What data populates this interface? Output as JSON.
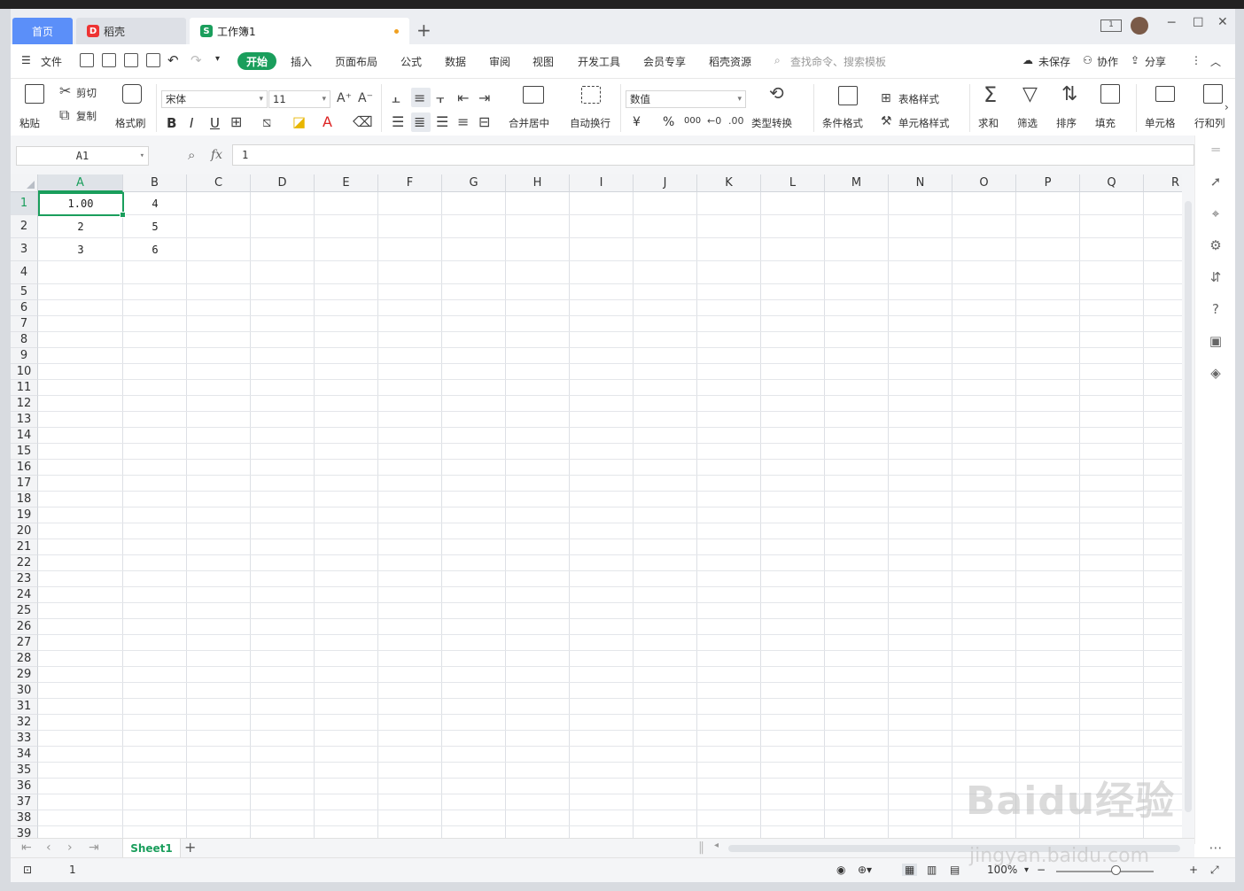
{
  "tabs": {
    "home": "首页",
    "daoke": "稻壳",
    "workbook": "工作簿1",
    "new_tab": "+"
  },
  "menu": {
    "file": "文件",
    "items": [
      "开始",
      "插入",
      "页面布局",
      "公式",
      "数据",
      "审阅",
      "视图",
      "开发工具",
      "会员专享",
      "稻壳资源"
    ],
    "search_placeholder": "查找命令、搜索模板",
    "unsaved": "未保存",
    "collaborate": "协作",
    "share": "分享"
  },
  "ribbon": {
    "paste": "粘贴",
    "cut": "剪切",
    "copy": "复制",
    "format_painter": "格式刷",
    "font_name": "宋体",
    "font_size": "11",
    "bold": "B",
    "italic": "I",
    "underline": "U",
    "merge_center": "合并居中",
    "auto_wrap": "自动换行",
    "number_format": "数值",
    "currency": "¥",
    "percent": "%",
    "thousands": "000",
    "type_convert": "类型转换",
    "conditional_format": "条件格式",
    "table_style": "表格样式",
    "cell_style": "单元格样式",
    "sum": "求和",
    "filter": "筛选",
    "sort": "排序",
    "fill": "填充",
    "cell": "单元格",
    "rows_cols": "行和列"
  },
  "formula_bar": {
    "cell_ref": "A1",
    "fx": "fx",
    "value": "1"
  },
  "grid": {
    "columns": [
      "A",
      "B",
      "C",
      "D",
      "E",
      "F",
      "G",
      "H",
      "I",
      "J",
      "K",
      "L",
      "M",
      "N",
      "O",
      "P",
      "Q",
      "R"
    ],
    "rows": [
      "1",
      "2",
      "3",
      "4",
      "5",
      "6",
      "7",
      "8",
      "9",
      "10",
      "11",
      "12",
      "13",
      "14",
      "15",
      "16",
      "17",
      "18",
      "19",
      "20",
      "21",
      "22",
      "23",
      "24",
      "25",
      "26",
      "27",
      "28",
      "29",
      "30",
      "31",
      "32",
      "33",
      "34",
      "35",
      "36",
      "37",
      "38",
      "39"
    ],
    "cells": {
      "A1": "1.00",
      "B1": "4",
      "A2": "2",
      "B2": "5",
      "A3": "3",
      "B3": "6"
    }
  },
  "sheets": {
    "active": "Sheet1",
    "add": "+"
  },
  "status": {
    "count": "1",
    "zoom": "100%"
  },
  "watermark": {
    "text": "Baidu经验",
    "url": "jingyan.baidu.com"
  }
}
